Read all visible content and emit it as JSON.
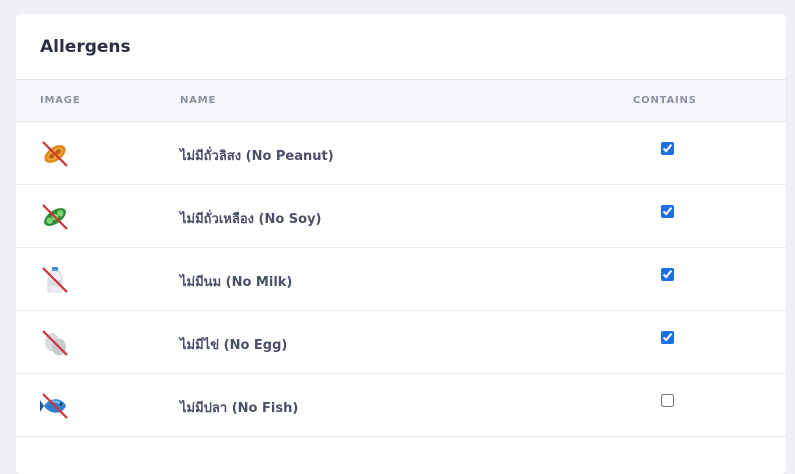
{
  "panel": {
    "title": "Allergens"
  },
  "table": {
    "columns": {
      "image": "IMAGE",
      "name": "NAME",
      "contains": "CONTAINS"
    },
    "rows": [
      {
        "icon": "no-peanut-icon",
        "name": "ไม่มีถั่วลิสง (No Peanut)",
        "contains": true
      },
      {
        "icon": "no-soy-icon",
        "name": "ไม่มีถั่วเหลือง (No Soy)",
        "contains": true
      },
      {
        "icon": "no-milk-icon",
        "name": "ไม่มีนม (No Milk)",
        "contains": true
      },
      {
        "icon": "no-egg-icon",
        "name": "ไม่มีไข่ (No Egg)",
        "contains": true
      },
      {
        "icon": "no-fish-icon",
        "name": "ไม่มีปลา (No Fish)",
        "contains": false
      }
    ]
  },
  "colors": {
    "accent": "#1b6fe0",
    "strike": "#d0333a",
    "header_bg": "#f4f6fa"
  }
}
